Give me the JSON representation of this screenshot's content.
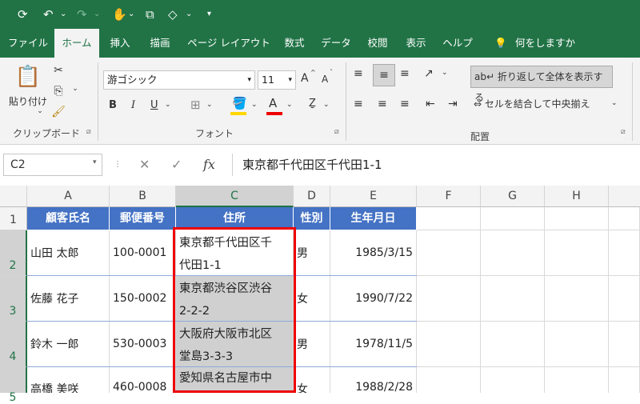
{
  "qat": {
    "icons": [
      "autosave-icon",
      "undo-icon",
      "undo-dropdown-icon",
      "redo-icon",
      "redo-dropdown-icon",
      "touch-mode-icon",
      "touch-mode-dropdown-icon",
      "screenshot-icon",
      "shape-icon",
      "shape-dropdown-icon",
      "customize-qat-icon"
    ]
  },
  "tabs": [
    "ファイル",
    "ホーム",
    "挿入",
    "描画",
    "ページ レイアウト",
    "数式",
    "データ",
    "校閲",
    "表示",
    "ヘルプ"
  ],
  "tell_me": "何をしますか",
  "ribbon": {
    "clipboard": {
      "paste_label": "貼り付け",
      "group_label": "クリップボード"
    },
    "font": {
      "font_name": "游ゴシック",
      "font_size": "11",
      "bold": "B",
      "italic": "I",
      "underline": "U",
      "font_color_letter": "A",
      "group_label": "フォント",
      "increase_font": "A",
      "decrease_font": "A"
    },
    "alignment": {
      "wrap_text_label": "折り返して全体を表示する",
      "merge_center_label": "セルを結合して中央揃え",
      "group_label": "配置"
    }
  },
  "formula_bar": {
    "name_box": "C2",
    "formula": "東京都千代田区千代田1-1",
    "fx": "fx"
  },
  "columns": [
    "A",
    "B",
    "C",
    "D",
    "E",
    "F",
    "G",
    "H"
  ],
  "rows": [
    "1",
    "2",
    "3",
    "4",
    "5"
  ],
  "table": {
    "headers": [
      "顧客氏名",
      "郵便番号",
      "住所",
      "性別",
      "生年月日"
    ],
    "data": [
      [
        "山田 太郎",
        "100-0001",
        "東京都千代田区千",
        "代田1-1",
        "男",
        "1985/3/15"
      ],
      [
        "佐藤 花子",
        "150-0002",
        "東京都渋谷区渋谷",
        "2-2-2",
        "女",
        "1990/7/22"
      ],
      [
        "鈴木 一郎",
        "530-0003",
        "大阪府大阪市北区",
        "堂島3-3-3",
        "男",
        "1978/11/5"
      ],
      [
        "高橋 美咲",
        "460-0008",
        "愛知県名古屋市中",
        "",
        "女",
        "1988/2/28"
      ]
    ]
  },
  "colors": {
    "excel_green": "#217346",
    "header_blue": "#4472c4",
    "highlight_red": "#e00000",
    "selection_gray": "#d0d0d0"
  }
}
